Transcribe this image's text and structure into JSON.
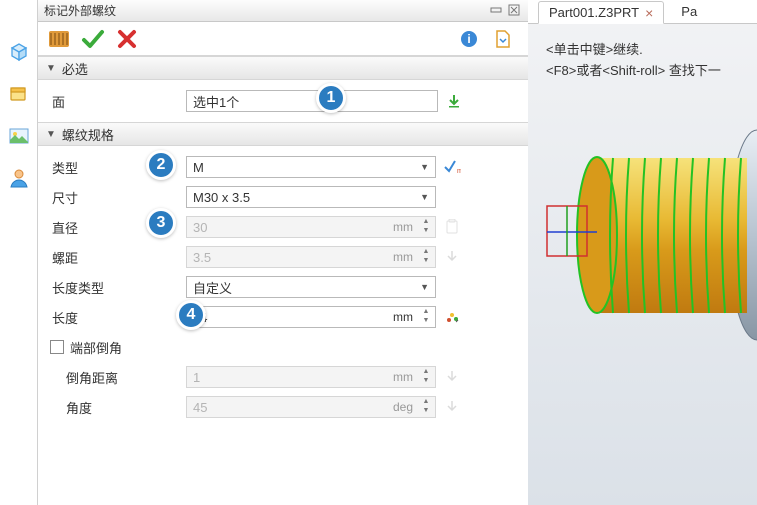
{
  "title": "标记外部螺纹",
  "tabs": [
    {
      "label": "Part001.Z3PRT",
      "active": true
    },
    {
      "label": "Pa",
      "active": false
    }
  ],
  "hints": {
    "line1": "<单击中键>继续.",
    "line2": "<F8>或者<Shift-roll> 查找下一"
  },
  "sections": {
    "required": "必选",
    "thread_spec": "螺纹规格"
  },
  "fields": {
    "face": {
      "label": "面",
      "value": "选中1个"
    },
    "type": {
      "label": "类型",
      "value": "M"
    },
    "size": {
      "label": "尺寸",
      "value": "M30 x 3.5"
    },
    "diameter": {
      "label": "直径",
      "value": "30",
      "unit": "mm"
    },
    "pitch": {
      "label": "螺距",
      "value": "3.5",
      "unit": "mm"
    },
    "length_type": {
      "label": "长度类型",
      "value": "自定义"
    },
    "length": {
      "label": "长度",
      "value": "24",
      "unit": "mm"
    },
    "end_chamfer": {
      "label": "端部倒角",
      "checked": false
    },
    "chamfer_dist": {
      "label": "倒角距离",
      "value": "1",
      "unit": "mm"
    },
    "angle": {
      "label": "角度",
      "value": "45",
      "unit": "deg"
    }
  },
  "callouts": [
    "1",
    "2",
    "3",
    "4"
  ]
}
